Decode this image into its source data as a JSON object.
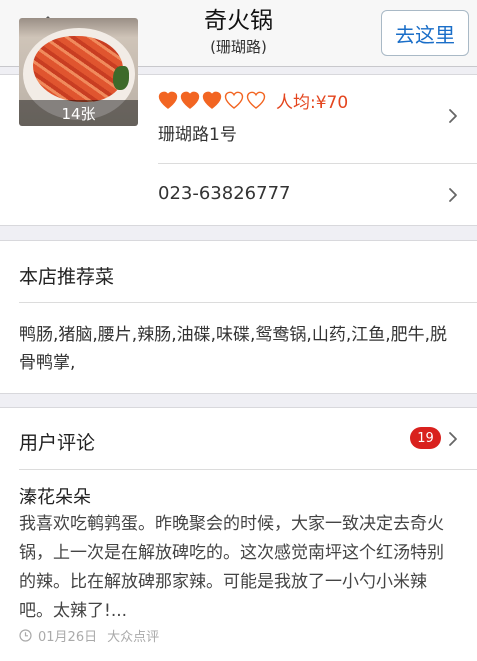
{
  "header": {
    "title": "奇火锅",
    "subtitle": "(珊瑚路)",
    "goto_label": "去这里"
  },
  "shop": {
    "photo_count": "14张",
    "rating": {
      "filled": 3,
      "total": 5
    },
    "avg_price": "人均:¥70",
    "address": "珊瑚路1号",
    "phone": "023-63826777"
  },
  "dishes": {
    "title": "本店推荐菜",
    "list": "鸭肠,猪脑,腰片,辣肠,油碟,味碟,鸳鸯锅,山药,江鱼,肥牛,脱骨鸭掌,"
  },
  "reviews": {
    "title": "用户评论",
    "count": "19",
    "latest": {
      "author": "溱花朵朵",
      "text": "我喜欢吃鹌鹑蛋。昨晚聚会的时候，大家一致决定去奇火锅，上一次是在解放碑吃的。这次感觉南坪这个红汤特别的辣。比在解放碑那家辣。可能是我放了一小勺小米辣吧。太辣了!...",
      "date": "01月26日",
      "source": "大众点评"
    }
  },
  "colors": {
    "accent": "#1a6ec8",
    "rating": "#f26522",
    "price": "#e4451e",
    "badge": "#d9211e"
  }
}
